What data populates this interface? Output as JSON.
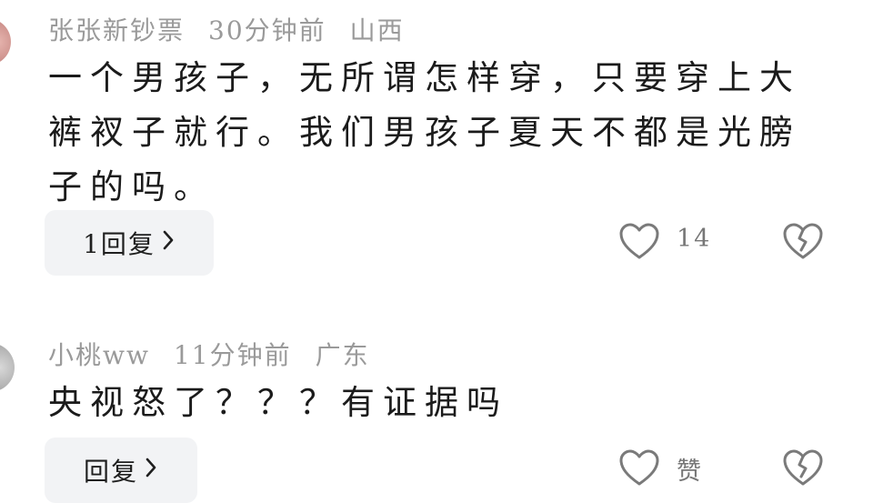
{
  "comments": [
    {
      "username": "张张新钞票",
      "time": "30分钟前",
      "location": "山西",
      "text": "一个男孩子，无所谓怎样穿，只要穿上大裤衩子就行。我们男孩子夏天不都是光膀子的吗。",
      "reply_label": "1回复",
      "like_count": "14",
      "icons": [
        "heart-outline-icon",
        "broken-heart-icon",
        "chevron-right-icon"
      ]
    },
    {
      "username": "小桃ww",
      "time": "11分钟前",
      "location": "广东",
      "text": "央视怒了？？？有证据吗",
      "reply_label": "回复",
      "like_count": "赞",
      "icons": [
        "heart-outline-icon",
        "broken-heart-icon",
        "chevron-right-icon"
      ]
    }
  ],
  "colors": {
    "meta_text": "#9a9a9a",
    "reply_bg": "#f2f3f5",
    "icon_stroke": "#7a7a7a"
  }
}
